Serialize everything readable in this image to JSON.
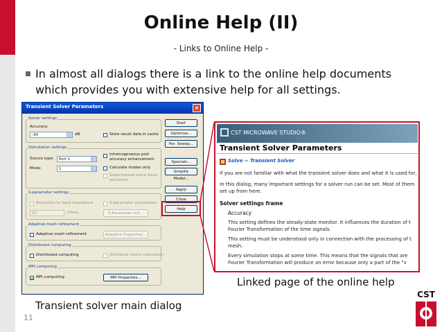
{
  "slide": {
    "title": "Online Help (II)",
    "subtitle": "- Links to Online Help -",
    "bullet_line1": "In almost all dialogs there is a link to the online help documents",
    "bullet_line2": "which provides you with extensive help for all settings.",
    "slide_number": "11",
    "caption_left": "Transient solver main dialog",
    "caption_right": "Linked page of the online help",
    "logo_text": "CST",
    "accent_color": "#c8102e"
  },
  "dialog": {
    "title": "Transient Solver Parameters",
    "solver_settings": {
      "label": "Solver settings",
      "accuracy_label": "Accuracy:",
      "accuracy_value": "-30",
      "accuracy_unit": "dB",
      "store_result": "Store result data in cache"
    },
    "stimulation": {
      "label": "Stimulation settings",
      "source_type_label": "Source type:",
      "source_type_value": "Port 1",
      "mode_label": "Mode:",
      "mode_value": "1",
      "inhomogeneous_line1": "Inhomogeneous port",
      "inhomogeneous_line2": "accuracy enhancement",
      "calculate_modes": "Calculate modes only",
      "superimpose_line1": "Superimpose plane wave",
      "superimpose_line2": "excitation"
    },
    "sparams": {
      "label": "S-parameter settings",
      "normalize": "Normalize to fixed impedance",
      "impedance_value": "50",
      "impedance_unit": "Ohms",
      "symmetries": "S-parameter symmetries",
      "list_button": "S-Parameter List..."
    },
    "adaptive": {
      "label": "Adaptive mesh refinement",
      "checkbox": "Adaptive mesh refinement",
      "button": "Adaptive Properties..."
    },
    "distributed": {
      "label": "Distributed computing",
      "checkbox": "Distributed computing",
      "matrix": "Distribute matrix calculation"
    },
    "mpi": {
      "label": "MPI computing",
      "checkbox": "MPI computing",
      "button": "MPI Properties..."
    },
    "buttons": {
      "start": "Start",
      "optimize": "Optimize...",
      "par_sweep": "Par. Sweep...",
      "specials": "Specials...",
      "simplify": "Simplify Model...",
      "apply": "Apply",
      "close": "Close",
      "help": "Help"
    }
  },
  "help_page": {
    "brand": "CST MICROWAVE STUDIO®",
    "title": "Transient Solver Parameters",
    "crumb_link1": "Solve",
    "crumb_arrow": "⇨",
    "crumb_link2": "Transient Solver",
    "para1": "If you are not familiar with what the transient solver does and what it is used for,",
    "para2_line1": "In this dialog, many important settings for a solver run can be set. Most of them",
    "para2_line2": "set up from here.",
    "section_heading": "Solver settings frame",
    "sub_heading": "Accuracy",
    "text1_line1": "This setting defines the steady-state monitor. It influences the duration of t",
    "text1_line2": "Fourier Transformation of the time signals.",
    "text2_line1": "This setting must be understood only in connection with the processing of t",
    "text2_line2": "mesh.",
    "text3_line1": "Every simulation stops at some time. This means that the signals that are",
    "text3_line2": "Fourier Transformation will produce an error because only a part of the \"v"
  }
}
